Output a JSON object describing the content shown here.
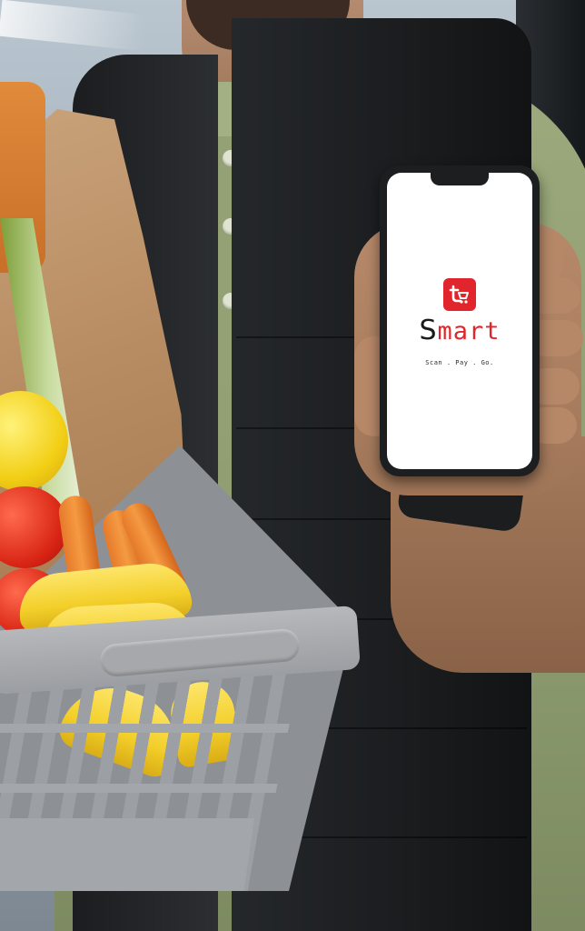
{
  "app": {
    "name_first": "S",
    "name_rest": "mart",
    "tagline": "Scan . Pay . Go.",
    "logo": "cart-icon",
    "logo_letter": "t",
    "accent": "#e0262c"
  },
  "scene": {
    "subject": "person-holding-grocery-basket-and-phone"
  }
}
